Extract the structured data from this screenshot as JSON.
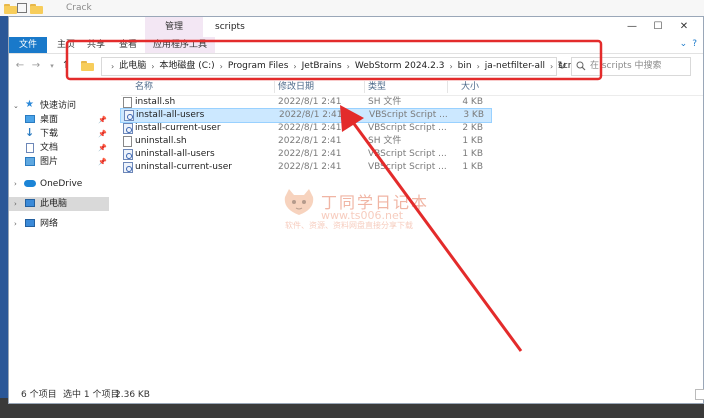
{
  "background_window": {
    "title": "Crack"
  },
  "titlebar": {
    "context_tab": "管理",
    "title": "scripts",
    "minimize": "—",
    "maximize": "☐",
    "close": "✕"
  },
  "ribbon": {
    "file": "文件",
    "tabs": [
      "主页",
      "共享",
      "查看",
      "应用程序工具"
    ],
    "help": "?"
  },
  "address": {
    "crumbs": [
      "此电脑",
      "本地磁盘 (C:)",
      "Program Files",
      "JetBrains",
      "WebStorm 2024.2.3",
      "bin",
      "ja-netfilter-all",
      "scripts"
    ],
    "search_placeholder": "在 scripts 中搜索"
  },
  "columns": {
    "name": "名称",
    "date": "修改日期",
    "type": "类型",
    "size": "大小"
  },
  "nav": [
    {
      "label": "快速访问",
      "icon": "star-icon",
      "pinned": false
    },
    {
      "label": "桌面",
      "icon": "desktop-icon",
      "pinned": true
    },
    {
      "label": "下载",
      "icon": "download-icon",
      "pinned": true
    },
    {
      "label": "文档",
      "icon": "documents-icon",
      "pinned": true
    },
    {
      "label": "图片",
      "icon": "pictures-icon",
      "pinned": true
    },
    {
      "label": "OneDrive",
      "icon": "cloud-icon",
      "pinned": false
    },
    {
      "label": "此电脑",
      "icon": "computer-icon",
      "pinned": false
    },
    {
      "label": "网络",
      "icon": "network-icon",
      "pinned": false
    }
  ],
  "files": [
    {
      "name": "install.sh",
      "date": "2022/8/1 2:41",
      "type": "SH 文件",
      "size": "4 KB",
      "icon": "sh-file-icon"
    },
    {
      "name": "install-all-users",
      "date": "2022/8/1 2:41",
      "type": "VBScript Script ...",
      "size": "3 KB",
      "icon": "vbscript-file-icon"
    },
    {
      "name": "install-current-user",
      "date": "2022/8/1 2:41",
      "type": "VBScript Script ...",
      "size": "2 KB",
      "icon": "vbscript-file-icon"
    },
    {
      "name": "uninstall.sh",
      "date": "2022/8/1 2:41",
      "type": "SH 文件",
      "size": "1 KB",
      "icon": "sh-file-icon"
    },
    {
      "name": "uninstall-all-users",
      "date": "2022/8/1 2:41",
      "type": "VBScript Script ...",
      "size": "1 KB",
      "icon": "vbscript-file-icon"
    },
    {
      "name": "uninstall-current-user",
      "date": "2022/8/1 2:41",
      "type": "VBScript Script ...",
      "size": "1 KB",
      "icon": "vbscript-file-icon"
    }
  ],
  "selected_file": "install-all-users",
  "status": {
    "count": "6 个项目",
    "selected": "选中 1 个项目",
    "size": "2.36 KB"
  },
  "watermark": {
    "title": "丁同学日记本",
    "url": "www.ts006.net",
    "subtitle": "软件、资源、资料网盘直接分享下载"
  },
  "colors": {
    "accent": "#1979ca",
    "selection": "#cce8ff",
    "annotation": "#e32b2b",
    "context_tab": "#f3e7f4"
  }
}
